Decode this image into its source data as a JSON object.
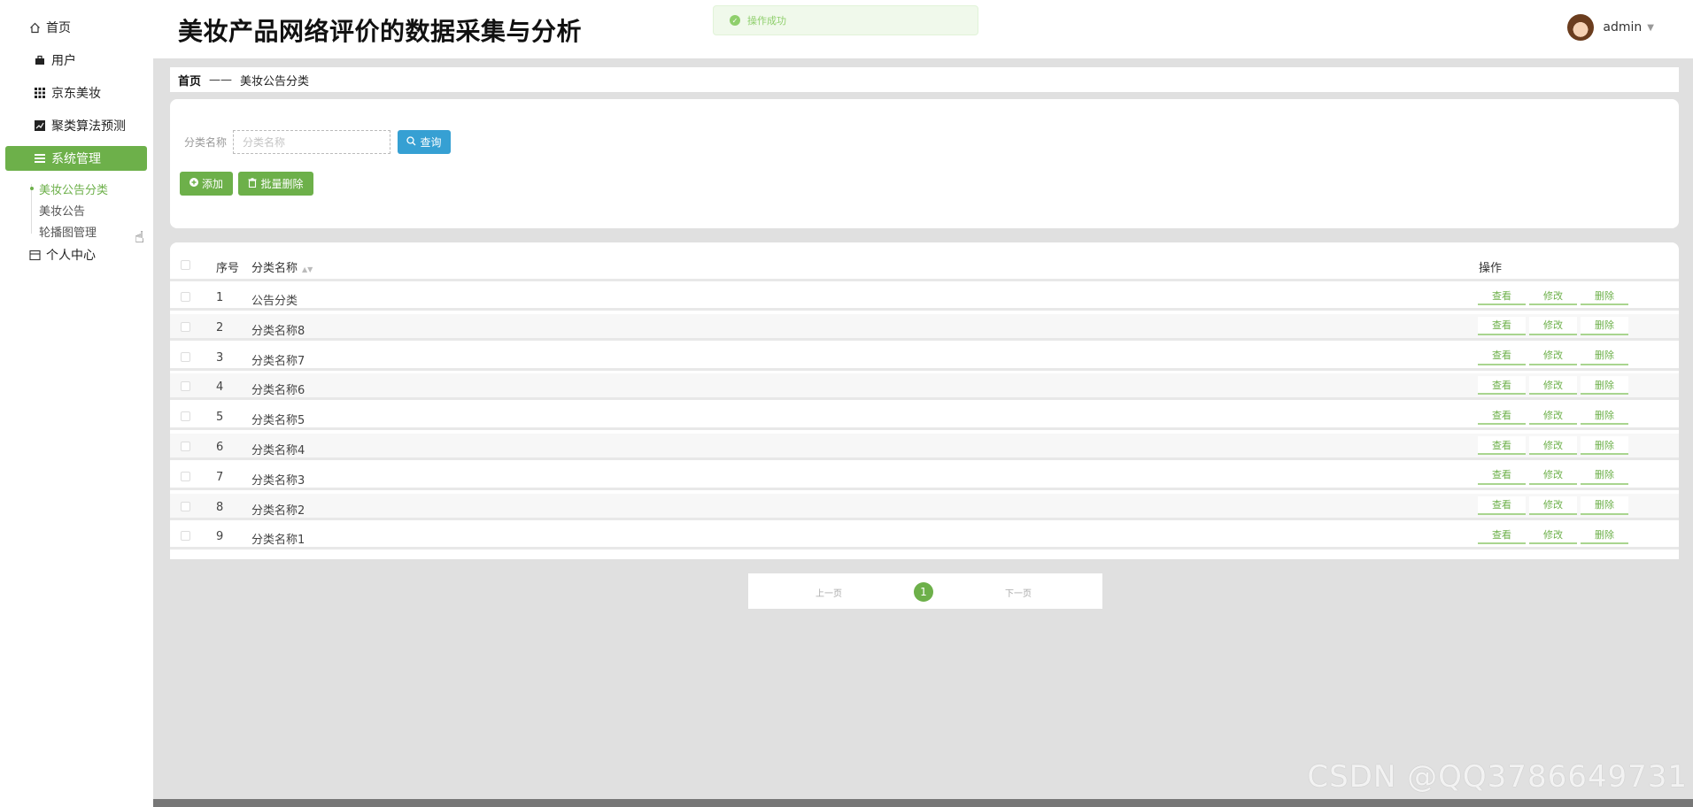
{
  "sidebar": {
    "items": [
      {
        "label": "首页",
        "icon": "home-icon"
      },
      {
        "label": "用户",
        "icon": "briefcase-icon"
      },
      {
        "label": "京东美妆",
        "icon": "grid-icon"
      },
      {
        "label": "聚类算法预测",
        "icon": "chart-icon"
      },
      {
        "label": "系统管理",
        "icon": "menu-icon"
      },
      {
        "label": "个人中心",
        "icon": "profile-icon"
      }
    ],
    "sub_items": [
      "美妆公告分类",
      "美妆公告",
      "轮播图管理"
    ]
  },
  "header": {
    "title": "美妆产品网络评价的数据采集与分析",
    "toast": "操作成功",
    "username": "admin"
  },
  "breadcrumb": {
    "home": "首页",
    "separator": "——",
    "current": "美妆公告分类"
  },
  "search": {
    "label": "分类名称",
    "placeholder": "分类名称",
    "search_button": "查询",
    "add_button": "添加",
    "batch_delete_button": "批量删除"
  },
  "table": {
    "headers": {
      "index": "序号",
      "name": "分类名称",
      "operation": "操作"
    },
    "rows": [
      {
        "index": "1",
        "name": "公告分类"
      },
      {
        "index": "2",
        "name": "分类名称8"
      },
      {
        "index": "3",
        "name": "分类名称7"
      },
      {
        "index": "4",
        "name": "分类名称6"
      },
      {
        "index": "5",
        "name": "分类名称5"
      },
      {
        "index": "6",
        "name": "分类名称4"
      },
      {
        "index": "7",
        "name": "分类名称3"
      },
      {
        "index": "8",
        "name": "分类名称2"
      },
      {
        "index": "9",
        "name": "分类名称1"
      }
    ],
    "actions": {
      "view": "查看",
      "edit": "修改",
      "delete": "删除"
    }
  },
  "pagination": {
    "prev": "上一页",
    "current": "1",
    "next": "下一页"
  },
  "watermark": "CSDN @QQ3786649731",
  "colors": {
    "accent": "#6db04a",
    "search_button": "#36a0d3",
    "background": "#e0e0e0"
  }
}
